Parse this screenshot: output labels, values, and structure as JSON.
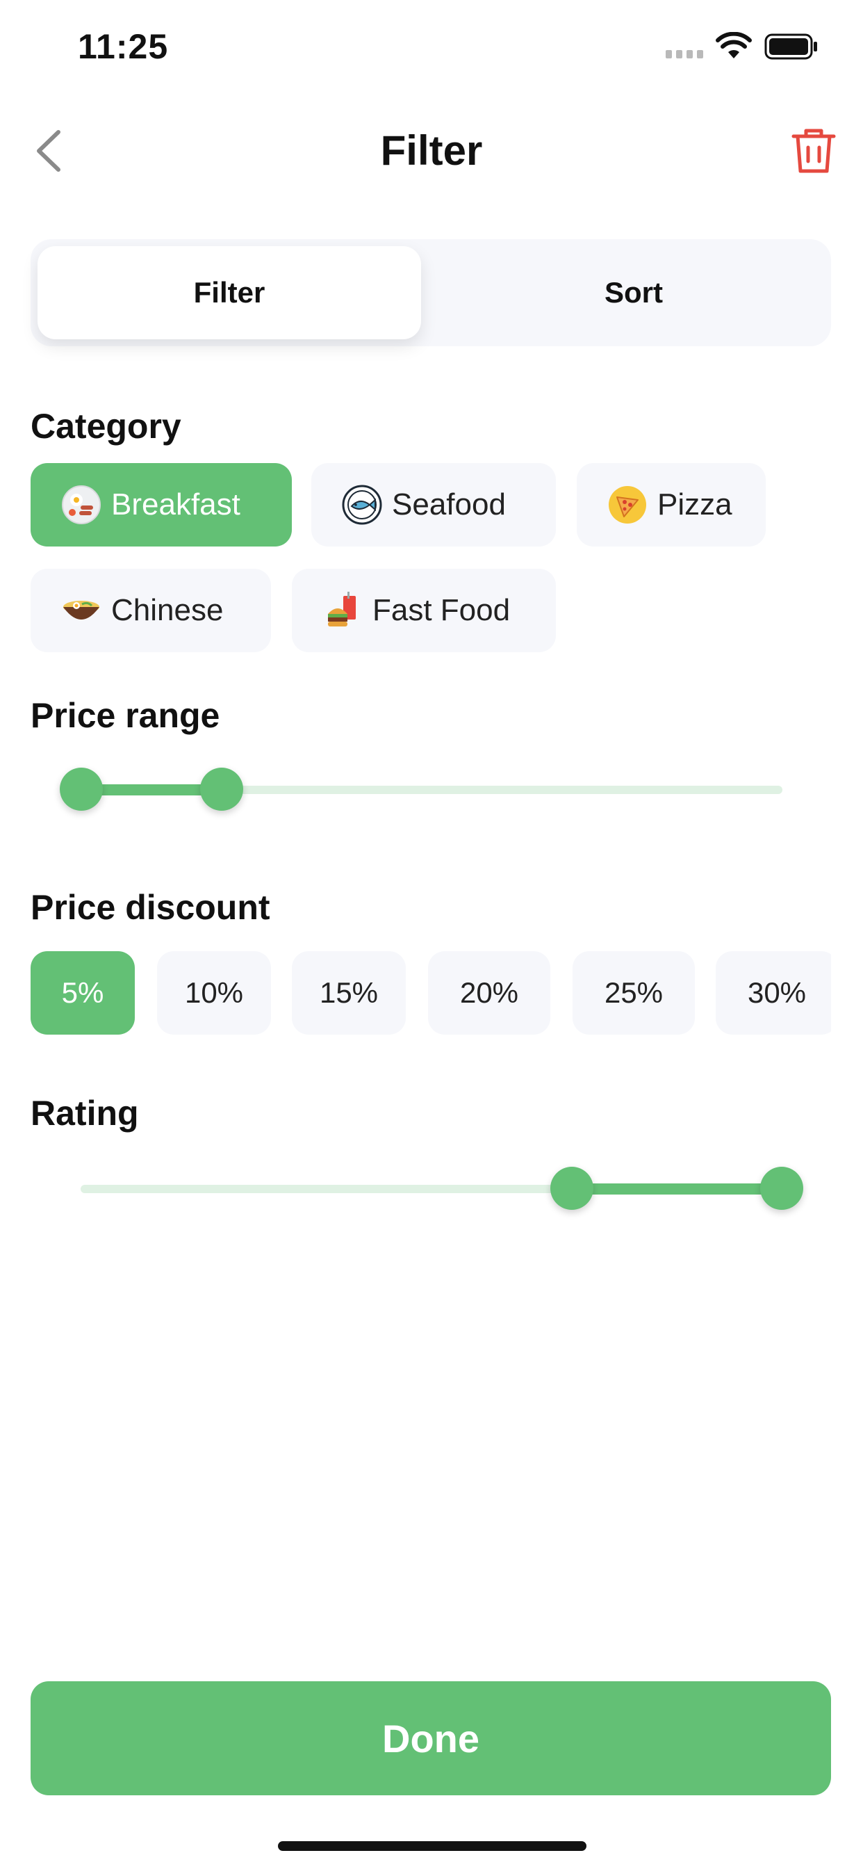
{
  "status_bar": {
    "time": "11:25"
  },
  "header": {
    "title": "Filter",
    "back_icon": "chevron-left-icon",
    "trash_icon": "trash-icon"
  },
  "tabs": [
    {
      "label": "Filter",
      "selected": true
    },
    {
      "label": "Sort",
      "selected": false
    }
  ],
  "category": {
    "title": "Category",
    "items": [
      {
        "label": "Breakfast",
        "icon": "breakfast-plate-icon",
        "selected": true
      },
      {
        "label": "Seafood",
        "icon": "fish-plate-icon",
        "selected": false
      },
      {
        "label": "Pizza",
        "icon": "pizza-icon",
        "selected": false
      },
      {
        "label": "Chinese",
        "icon": "noodle-bowl-icon",
        "selected": false
      },
      {
        "label": "Fast Food",
        "icon": "burger-drink-icon",
        "selected": false
      }
    ]
  },
  "price_range": {
    "title": "Price range",
    "low": 0,
    "high": 0.2
  },
  "price_discount": {
    "title": "Price discount",
    "options": [
      "5%",
      "10%",
      "15%",
      "20%",
      "25%",
      "30%"
    ],
    "selected": "5%"
  },
  "rating": {
    "title": "Rating",
    "low": 0.7,
    "high": 1.0
  },
  "done_label": "Done",
  "colors": {
    "accent": "#63c075",
    "chip_bg": "#f6f7fb",
    "track": "#dff1e3",
    "danger": "#e5493f"
  }
}
